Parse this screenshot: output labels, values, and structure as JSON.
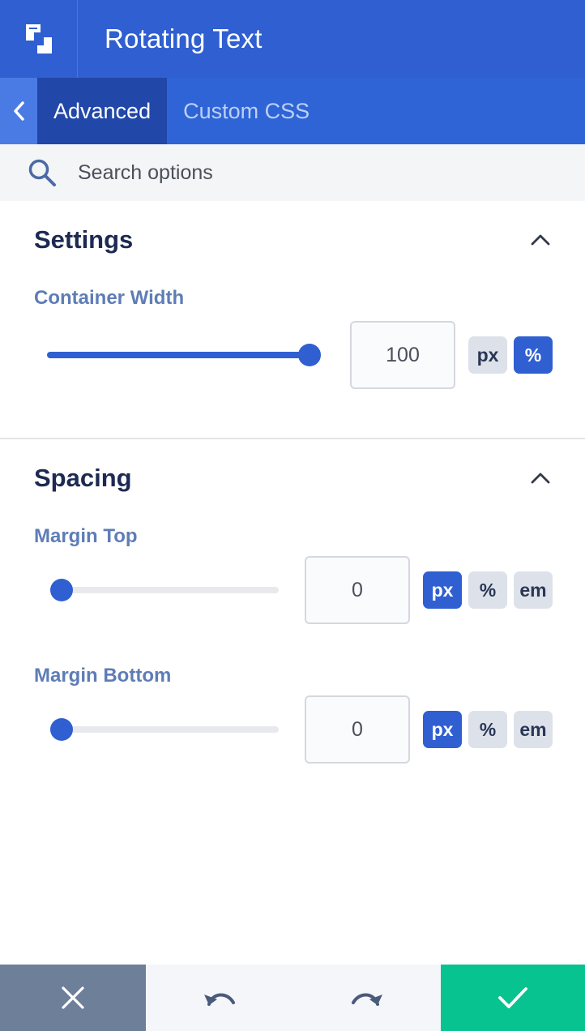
{
  "header": {
    "title": "Rotating Text",
    "logo_icon": "builder-logo-icon"
  },
  "tabs": [
    {
      "label": "Advanced",
      "active": true
    },
    {
      "label": "Custom CSS",
      "active": false
    }
  ],
  "search": {
    "placeholder": "Search options",
    "value": ""
  },
  "sections": {
    "settings": {
      "title": "Settings",
      "fields": {
        "container_width": {
          "label": "Container Width",
          "value": "100",
          "slider_fraction": 1.0,
          "units": [
            "px",
            "%"
          ],
          "active_unit": "%"
        }
      }
    },
    "spacing": {
      "title": "Spacing",
      "fields": {
        "margin_top": {
          "label": "Margin Top",
          "value": "0",
          "slider_fraction": 0.0,
          "units": [
            "px",
            "%",
            "em"
          ],
          "active_unit": "px"
        },
        "margin_bottom": {
          "label": "Margin Bottom",
          "value": "0",
          "slider_fraction": 0.0,
          "units": [
            "px",
            "%",
            "em"
          ],
          "active_unit": "px"
        }
      }
    }
  },
  "footer": {
    "buttons": [
      "close-icon",
      "undo-icon",
      "redo-icon",
      "check-icon"
    ]
  },
  "colors": {
    "primary": "#2f5fd0",
    "confirm": "#07c38f",
    "cancel": "#6e7f9a",
    "label": "#5e7db6",
    "title": "#1d2a52"
  }
}
